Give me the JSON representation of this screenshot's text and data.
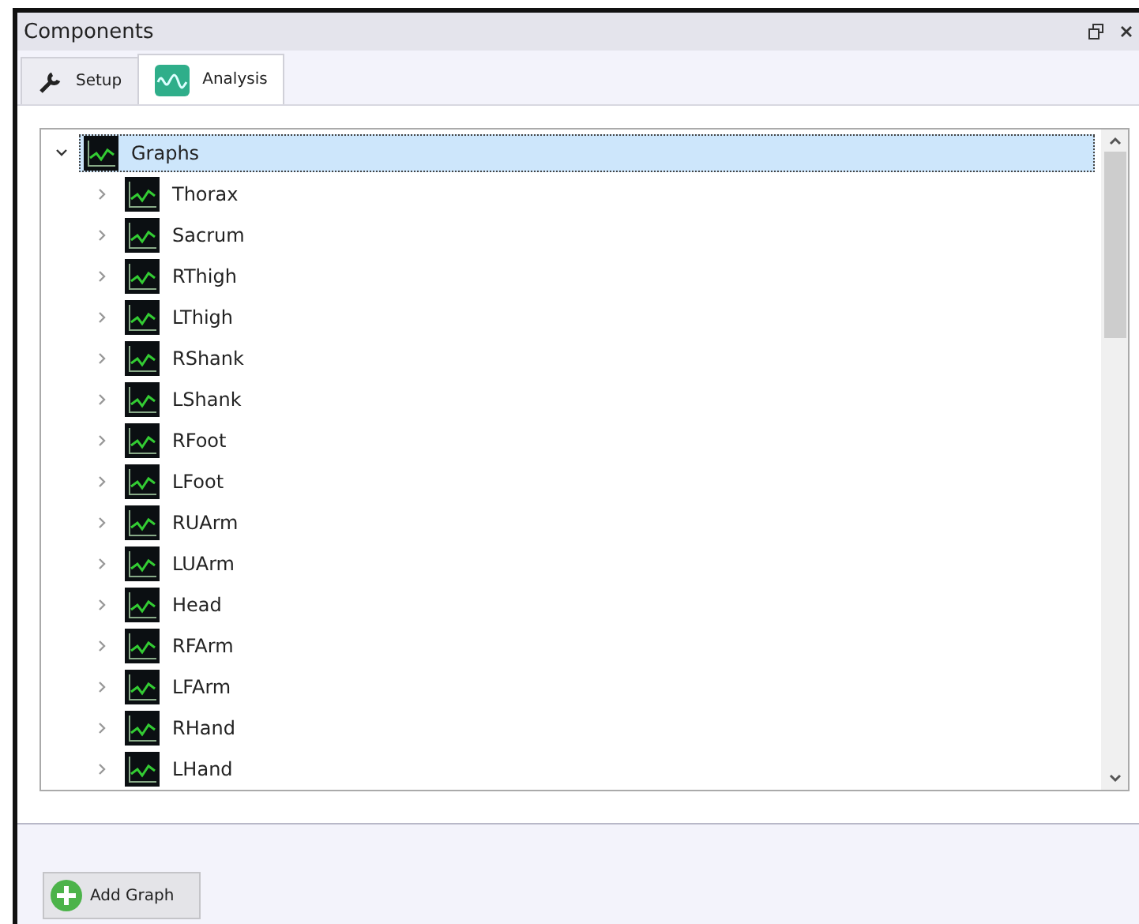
{
  "panel": {
    "title": "Components"
  },
  "tabs": [
    {
      "label": "Setup",
      "kind": "wrench",
      "selected": false
    },
    {
      "label": "Analysis",
      "kind": "wave",
      "selected": true
    }
  ],
  "tree": [
    {
      "label": "Graphs",
      "expanded": true,
      "selected": true,
      "children": [
        {
          "label": "Thorax",
          "expanded": false,
          "selected": false
        },
        {
          "label": "Sacrum",
          "expanded": false,
          "selected": false
        },
        {
          "label": "RThigh",
          "expanded": false,
          "selected": false
        },
        {
          "label": "LThigh",
          "expanded": false,
          "selected": false
        },
        {
          "label": "RShank",
          "expanded": false,
          "selected": false
        },
        {
          "label": "LShank",
          "expanded": false,
          "selected": false
        },
        {
          "label": "RFoot",
          "expanded": false,
          "selected": false
        },
        {
          "label": "LFoot",
          "expanded": false,
          "selected": false
        },
        {
          "label": "RUArm",
          "expanded": false,
          "selected": false
        },
        {
          "label": "LUArm",
          "expanded": false,
          "selected": false
        },
        {
          "label": "Head",
          "expanded": false,
          "selected": false
        },
        {
          "label": "RFArm",
          "expanded": false,
          "selected": false
        },
        {
          "label": "LFArm",
          "expanded": false,
          "selected": false
        },
        {
          "label": "RHand",
          "expanded": false,
          "selected": false
        },
        {
          "label": "LHand",
          "expanded": false,
          "selected": false
        }
      ]
    }
  ],
  "add_button": {
    "label": "Add Graph"
  }
}
